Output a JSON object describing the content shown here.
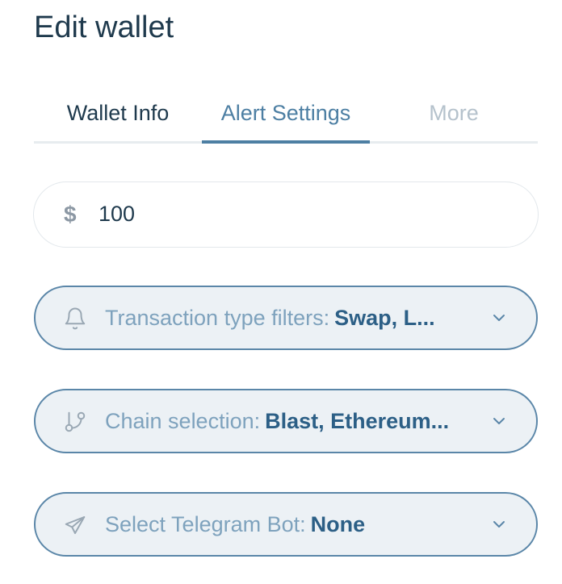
{
  "page": {
    "title": "Edit wallet"
  },
  "tabs": {
    "wallet_info": "Wallet Info",
    "alert_settings": "Alert Settings",
    "more": "More",
    "active": "Alert Settings"
  },
  "amount": {
    "currency_symbol": "$",
    "value": "100"
  },
  "filters": {
    "transaction_type": {
      "label": "Transaction type filters:",
      "value": "Swap, L...",
      "icon": "bell-icon"
    },
    "chain_selection": {
      "label": "Chain selection:",
      "value": "Blast, Ethereum...",
      "icon": "branch-icon"
    },
    "telegram_bot": {
      "label": "Select Telegram Bot:",
      "value": "None",
      "icon": "send-icon"
    }
  },
  "colors": {
    "accent": "#4d7fa3",
    "title": "#1f3a4d",
    "select_background": "#ecf1f5",
    "select_border": "#5a86a8",
    "muted_tab": "#b5c2cc"
  }
}
